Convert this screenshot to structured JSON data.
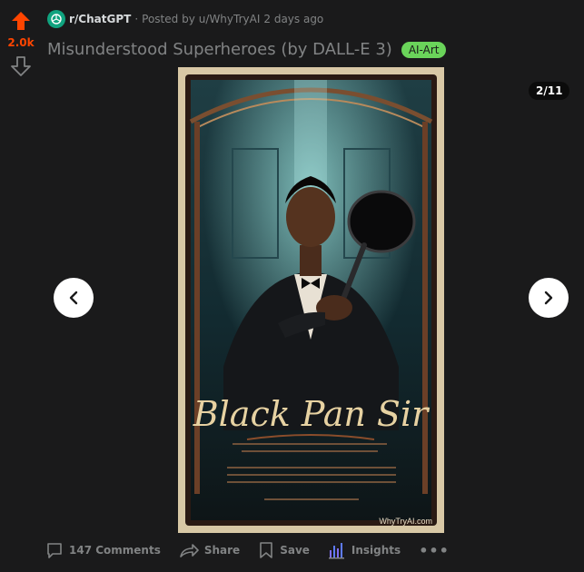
{
  "vote": {
    "score": "2.0k"
  },
  "post": {
    "subreddit": "r/ChatGPT",
    "separator": "·",
    "posted_by_prefix": "Posted by",
    "author": "u/WhyTryAI",
    "time_ago": "2 days ago",
    "title": "Misunderstood Superheroes (by DALL-E 3)",
    "flair": "AI-Art"
  },
  "gallery": {
    "counter": "2/11",
    "image": {
      "poster_title": "Black Pan Sir",
      "watermark": "WhyTryAI.com"
    }
  },
  "actions": {
    "comments": "147 Comments",
    "share": "Share",
    "save": "Save",
    "insights": "Insights",
    "more": "•••"
  },
  "colors": {
    "background": "#1a1a1b",
    "upvote": "#ff4500",
    "flair": "#6ad45a",
    "subreddit_icon": "#10a37f",
    "muted_text": "#818384"
  }
}
